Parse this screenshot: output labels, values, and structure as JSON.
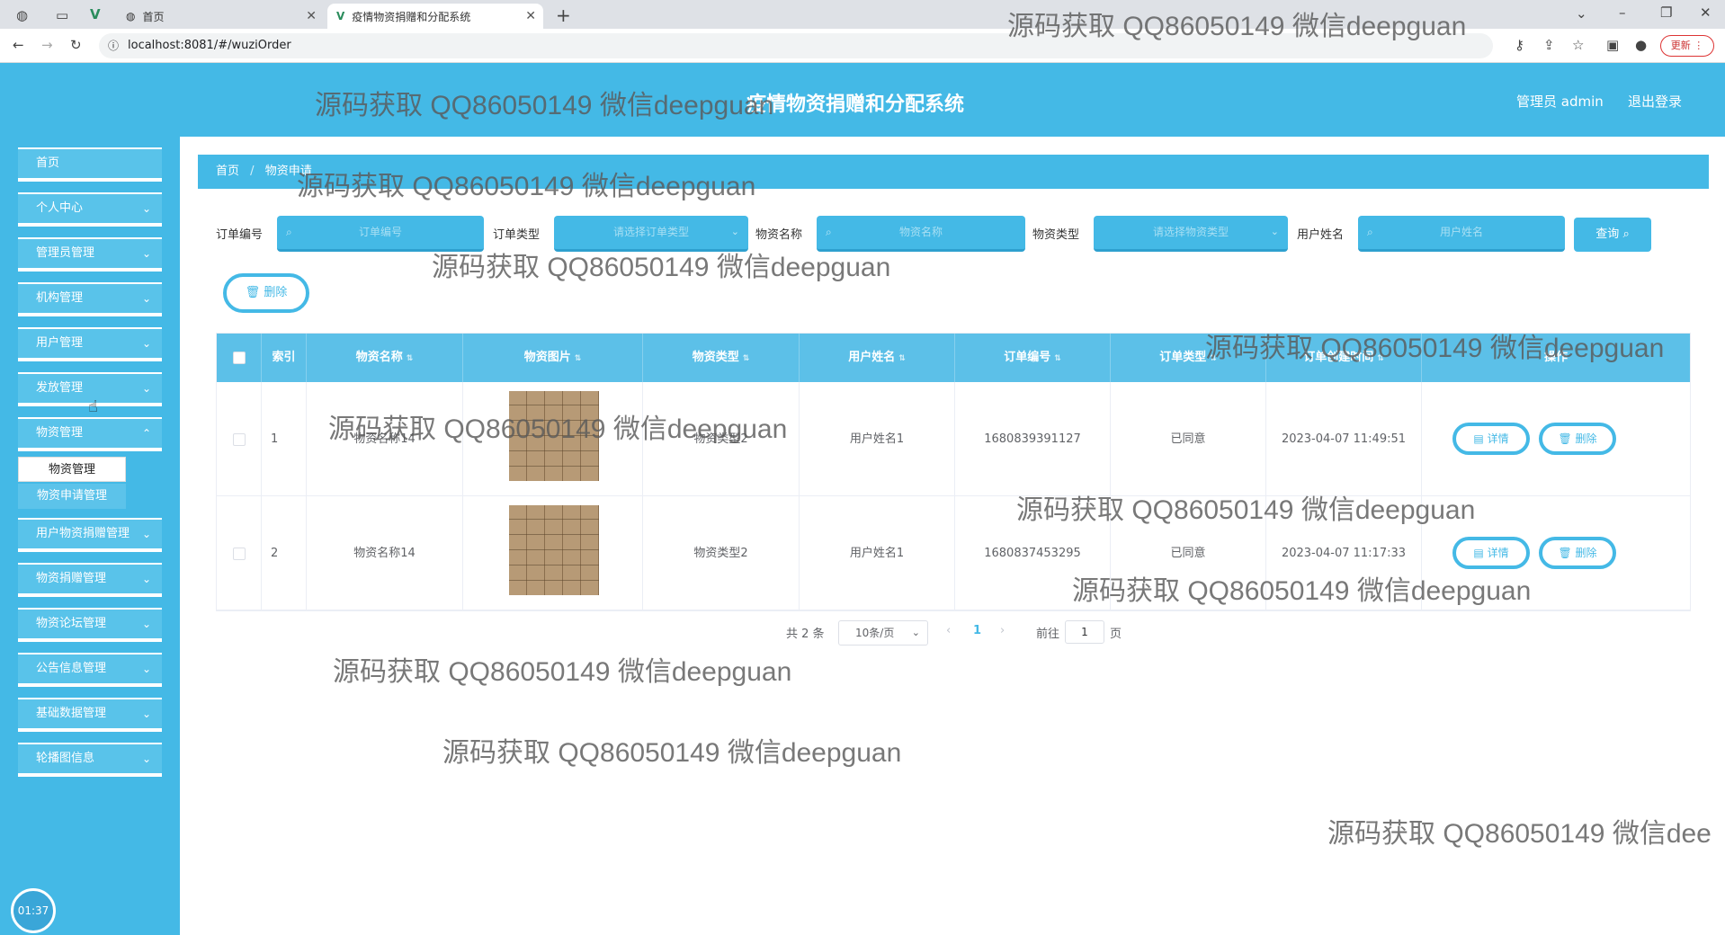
{
  "browser": {
    "tabs": [
      {
        "label": "首页"
      },
      {
        "label": "疫情物资捐赠和分配系统"
      }
    ],
    "url": "localhost:8081/#/wuziOrder",
    "update_label": "更新"
  },
  "header": {
    "title": "疫情物资捐赠和分配系统",
    "admin": "管理员 admin",
    "logout": "退出登录"
  },
  "sidebar": {
    "items": [
      {
        "label": "首页"
      },
      {
        "label": "个人中心"
      },
      {
        "label": "管理员管理"
      },
      {
        "label": "机构管理"
      },
      {
        "label": "用户管理"
      },
      {
        "label": "发放管理"
      },
      {
        "label": "物资管理"
      },
      {
        "label": "用户物资捐赠管理"
      },
      {
        "label": "物资捐赠管理"
      },
      {
        "label": "物资论坛管理"
      },
      {
        "label": "公告信息管理"
      },
      {
        "label": "基础数据管理"
      },
      {
        "label": "轮播图信息"
      }
    ],
    "submenu": [
      {
        "label": "物资管理"
      },
      {
        "label": "物资申请管理"
      }
    ],
    "clock": "01:37"
  },
  "breadcrumb": {
    "home": "首页",
    "sep": "/",
    "current": "物资申请"
  },
  "search": {
    "order_no_label": "订单编号",
    "order_no_placeholder": "订单编号",
    "order_type_label": "订单类型",
    "order_type_placeholder": "请选择订单类型",
    "goods_name_label": "物资名称",
    "goods_name_placeholder": "物资名称",
    "goods_type_label": "物资类型",
    "goods_type_placeholder": "请选择物资类型",
    "user_name_label": "用户姓名",
    "user_name_placeholder": "用户姓名",
    "query_btn": "查询"
  },
  "toolbar": {
    "delete_label": "删除"
  },
  "table": {
    "columns": [
      "索引",
      "物资名称",
      "物资图片",
      "物资类型",
      "用户姓名",
      "订单编号",
      "订单类型",
      "订单创建时间",
      "操作"
    ],
    "rows": [
      {
        "index": "1",
        "name": "物资名称14",
        "type": "物资类型2",
        "user": "用户姓名1",
        "order_no": "1680839391127",
        "order_type": "已同意",
        "created": "2023-04-07 11:49:51"
      },
      {
        "index": "2",
        "name": "物资名称14",
        "type": "物资类型2",
        "user": "用户姓名1",
        "order_no": "1680837453295",
        "order_type": "已同意",
        "created": "2023-04-07 11:17:33"
      }
    ],
    "detail_label": "详情",
    "delete_label": "删除"
  },
  "pagination": {
    "total": "共 2 条",
    "page_size": "10条/页",
    "current_page": "1",
    "goto_label": "前往",
    "goto_value": "1",
    "page_unit": "页"
  },
  "watermark": {
    "text": "源码获取 QQ86050149 微信deepguan",
    "partial": "源码获取 QQ86050149 微信dee"
  },
  "colors": {
    "primary": "#44b9e6",
    "accent_dark": "#2ea0cf"
  }
}
